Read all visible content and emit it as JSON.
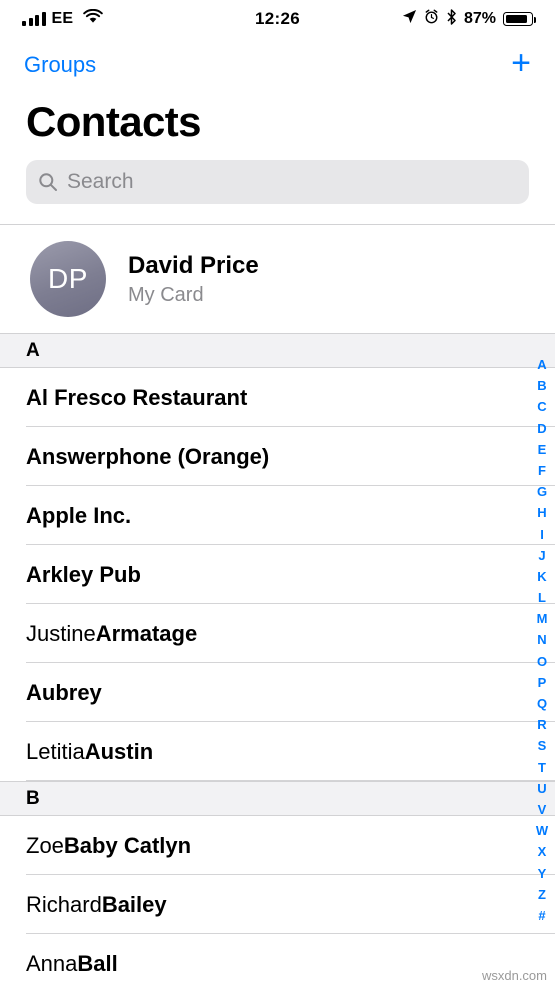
{
  "status_bar": {
    "carrier": "EE",
    "time": "12:26",
    "battery_pct": "87%",
    "icons": [
      "signal-bars-icon",
      "wifi-icon",
      "location-arrow-icon",
      "alarm-clock-icon",
      "bluetooth-icon",
      "battery-icon"
    ]
  },
  "nav": {
    "left_label": "Groups",
    "add_label": "+"
  },
  "title": "Contacts",
  "search": {
    "placeholder": "Search",
    "value": ""
  },
  "my_card": {
    "initials": "DP",
    "name": "David Price",
    "subtitle": "My Card"
  },
  "sections": [
    {
      "letter": "A",
      "rows": [
        {
          "first": "",
          "last": "Al Fresco Restaurant"
        },
        {
          "first": "",
          "last": "Answerphone (Orange)"
        },
        {
          "first": "",
          "last": "Apple Inc."
        },
        {
          "first": "",
          "last": "Arkley Pub"
        },
        {
          "first": "Justine ",
          "last": "Armatage"
        },
        {
          "first": "",
          "last": "Aubrey"
        },
        {
          "first": "Letitia ",
          "last": "Austin"
        }
      ]
    },
    {
      "letter": "B",
      "rows": [
        {
          "first": "Zoe ",
          "last": "Baby Catlyn"
        },
        {
          "first": "Richard ",
          "last": "Bailey"
        },
        {
          "first": "Anna ",
          "last": "Ball"
        }
      ]
    }
  ],
  "index_bar": [
    "A",
    "B",
    "C",
    "D",
    "E",
    "F",
    "G",
    "H",
    "I",
    "J",
    "K",
    "L",
    "M",
    "N",
    "O",
    "P",
    "Q",
    "R",
    "S",
    "T",
    "U",
    "V",
    "W",
    "X",
    "Y",
    "Z",
    "#"
  ],
  "watermark": "wsxdn.com",
  "colors": {
    "accent": "#007aff",
    "search_bg": "#e7e7e9",
    "section_bg": "#f2f2f4",
    "secondary_text": "#8a8a8e"
  }
}
